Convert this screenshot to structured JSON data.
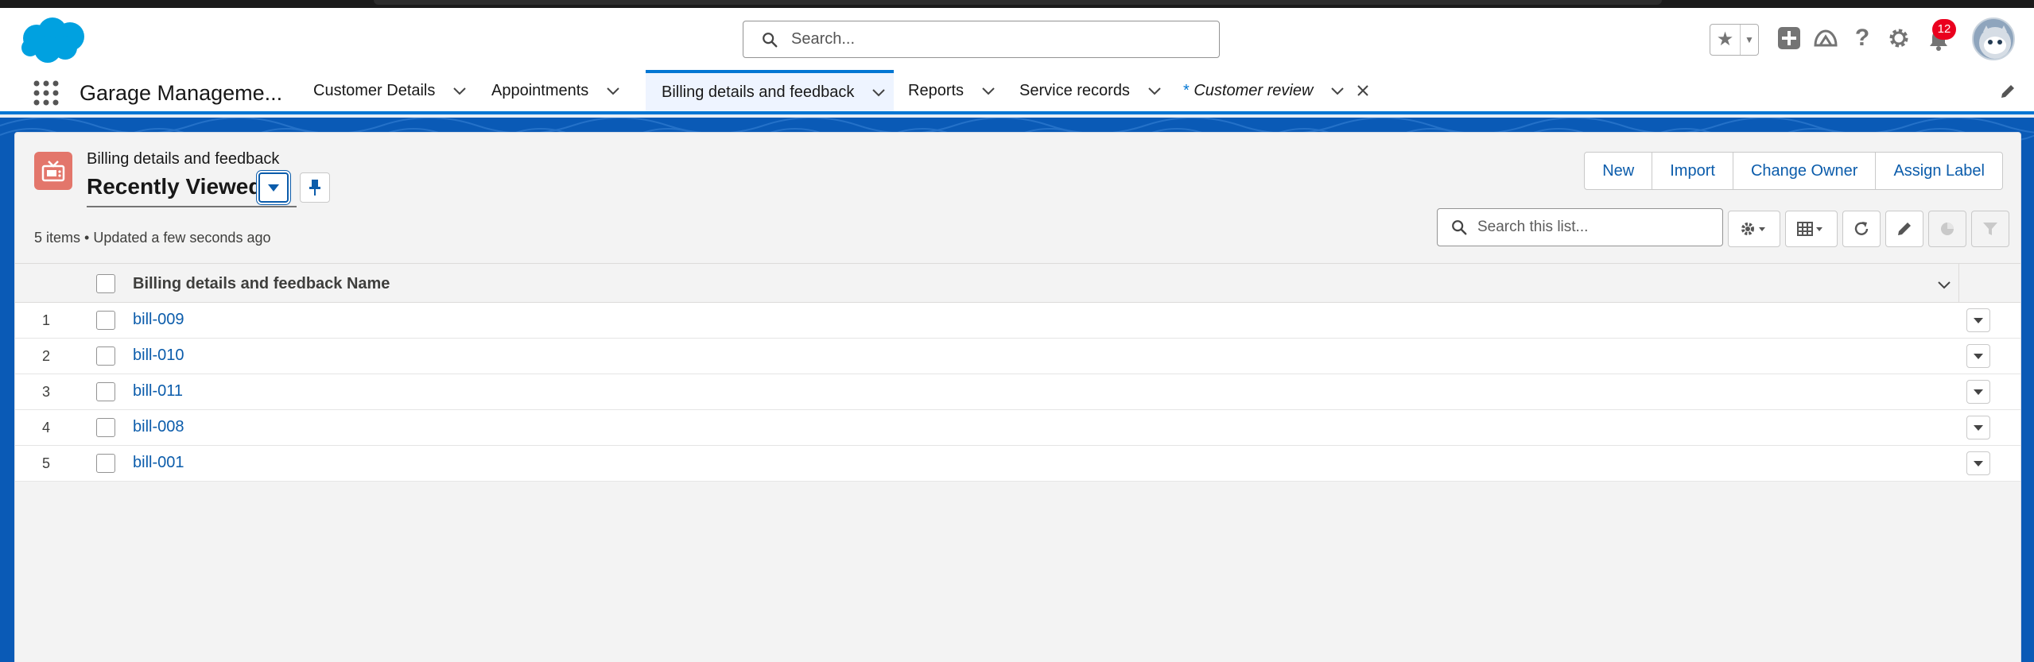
{
  "global_header": {
    "search_placeholder": "Search...",
    "notification_count": "12",
    "icons": [
      "favorites-star-icon",
      "add-icon",
      "trailhead-icon",
      "help-icon",
      "setup-gear-icon",
      "notifications-bell-icon",
      "avatar"
    ]
  },
  "nav": {
    "app_name": "Garage Manageme...",
    "tabs": [
      {
        "label": "Customer Details",
        "active": false
      },
      {
        "label": "Appointments",
        "active": false
      },
      {
        "label": "Billing details and feedback",
        "active": true
      },
      {
        "label": "Reports",
        "active": false
      },
      {
        "label": "Service records",
        "active": false
      },
      {
        "label": "Customer review",
        "active": false,
        "unsaved_marker": "*",
        "closable": true
      }
    ]
  },
  "list_view": {
    "object_label": "Billing details and feedback",
    "title": "Recently Viewed",
    "meta": "5 items • Updated a few seconds ago",
    "search_placeholder": "Search this list...",
    "actions": {
      "new": "New",
      "import": "Import",
      "change_owner": "Change Owner",
      "assign_label": "Assign Label"
    },
    "column_header": "Billing details and feedback Name",
    "rows": [
      {
        "num": "1",
        "name": "bill-009"
      },
      {
        "num": "2",
        "name": "bill-010"
      },
      {
        "num": "3",
        "name": "bill-011"
      },
      {
        "num": "4",
        "name": "bill-008"
      },
      {
        "num": "5",
        "name": "bill-001"
      }
    ]
  },
  "colors": {
    "brand_blue": "#0176d3",
    "link_blue": "#0b5cab",
    "object_icon": "#e3766b",
    "badge_red": "#ea001e"
  }
}
